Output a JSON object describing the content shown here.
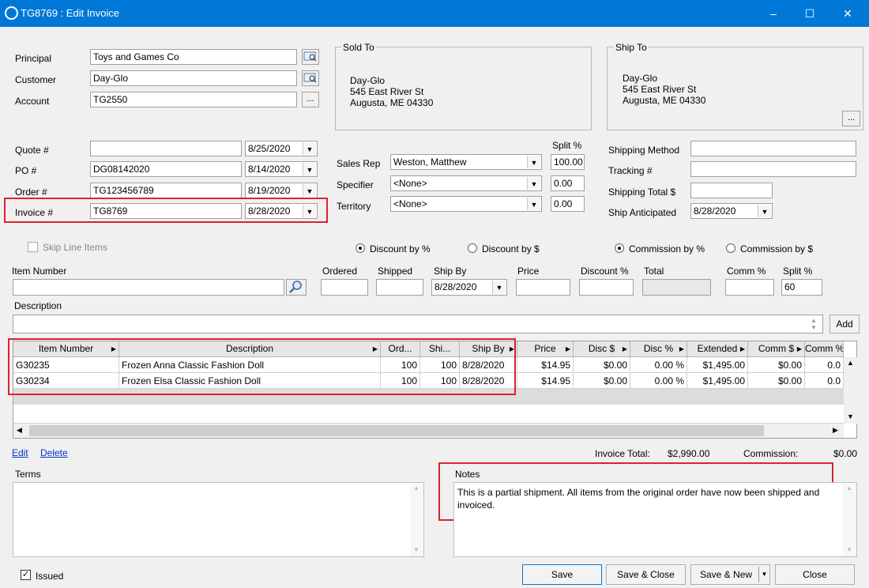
{
  "window": {
    "title": "TG8769 : Edit Invoice",
    "minimize": "–",
    "maximize": "☐",
    "close": "✕"
  },
  "header": {
    "principal_label": "Principal",
    "principal_value": "Toys and Games Co",
    "customer_label": "Customer",
    "customer_value": "Day-Glo",
    "account_label": "Account",
    "account_value": "TG2550",
    "browse": "..."
  },
  "sold_to": {
    "title": "Sold To",
    "line1": "Day-Glo",
    "line2": "545 East River St",
    "line3": "Augusta, ME 04330"
  },
  "ship_to": {
    "title": "Ship To",
    "line1": "Day-Glo",
    "line2": "545 East River St",
    "line3": "Augusta, ME 04330",
    "browse": "..."
  },
  "refs": {
    "quote_label": "Quote #",
    "quote_value": "",
    "quote_date": "8/25/2020",
    "po_label": "PO #",
    "po_value": "DG08142020",
    "po_date": "8/14/2020",
    "order_label": "Order #",
    "order_value": "TG123456789",
    "order_date": "8/19/2020",
    "invoice_label": "Invoice #",
    "invoice_value": "TG8769",
    "invoice_date": "8/28/2020"
  },
  "reps": {
    "split_header": "Split %",
    "sales_rep_label": "Sales Rep",
    "sales_rep_value": "Weston, Matthew",
    "sales_rep_split": "100.00",
    "specifier_label": "Specifier",
    "specifier_value": "<None>",
    "specifier_split": "0.00",
    "territory_label": "Territory",
    "territory_value": "<None>",
    "territory_split": "0.00"
  },
  "shipping": {
    "method_label": "Shipping Method",
    "method_value": "",
    "tracking_label": "Tracking #",
    "tracking_value": "",
    "total_label": "Shipping Total $",
    "total_value": "",
    "anticipated_label": "Ship Anticipated",
    "anticipated_value": "8/28/2020"
  },
  "options": {
    "skip_line_items": "Skip Line Items",
    "discount_pct": "Discount by %",
    "discount_amt": "Discount by $",
    "commission_pct": "Commission by %",
    "commission_amt": "Commission by $"
  },
  "entry": {
    "item_number_label": "Item Number",
    "ordered_label": "Ordered",
    "shipped_label": "Shipped",
    "ship_by_label": "Ship By",
    "ship_by_value": "8/28/2020",
    "price_label": "Price",
    "discount_label": "Discount %",
    "total_label": "Total",
    "comm_label": "Comm %",
    "split_label": "Split %",
    "split_value": "60",
    "description_label": "Description",
    "add_button": "Add"
  },
  "grid": {
    "columns": [
      "Item Number",
      "Description",
      "Ord...",
      "Shi...",
      "Ship By",
      "Price",
      "Disc $",
      "Disc %",
      "Extended",
      "Comm $",
      "Comm %"
    ],
    "rows": [
      [
        "G30235",
        "Frozen Anna Classic Fashion Doll",
        "100",
        "100",
        "8/28/2020",
        "$14.95",
        "$0.00",
        "0.00 %",
        "$1,495.00",
        "$0.00",
        "0.0"
      ],
      [
        "G30234",
        "Frozen Elsa Classic Fashion Doll",
        "100",
        "100",
        "8/28/2020",
        "$14.95",
        "$0.00",
        "0.00 %",
        "$1,495.00",
        "$0.00",
        "0.0"
      ]
    ]
  },
  "footer": {
    "edit_link": "Edit",
    "delete_link": "Delete",
    "invoice_total_label": "Invoice Total:",
    "invoice_total_value": "$2,990.00",
    "commission_label": "Commission:",
    "commission_value": "$0.00",
    "terms_label": "Terms",
    "terms_value": "",
    "notes_label": "Notes",
    "notes_value": "This is a partial shipment.  All items from the original order have now been shipped and invoiced.",
    "issued_label": "Issued",
    "save": "Save",
    "save_close": "Save & Close",
    "save_new": "Save & New",
    "close": "Close"
  }
}
